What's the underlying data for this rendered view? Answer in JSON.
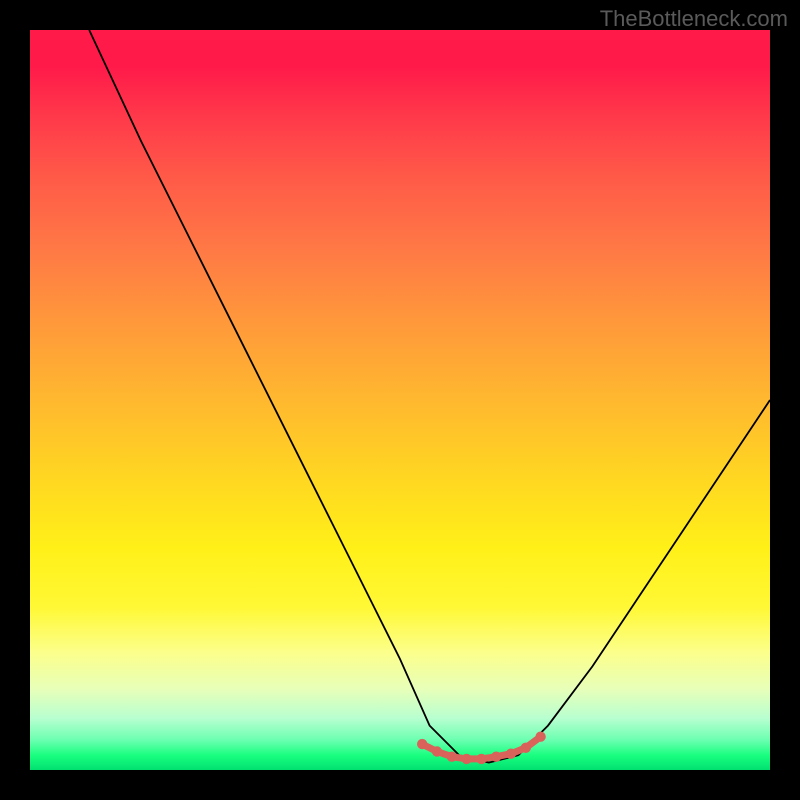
{
  "watermark": "TheBottleneck.com",
  "chart_data": {
    "type": "line",
    "title": "",
    "xlabel": "",
    "ylabel": "",
    "xlim": [
      0,
      100
    ],
    "ylim": [
      0,
      100
    ],
    "grid": false,
    "annotations": [],
    "series": [
      {
        "name": "curve",
        "color": "#000000",
        "x": [
          8,
          15,
          22,
          29,
          36,
          43,
          50,
          54,
          58,
          62,
          66,
          70,
          76,
          82,
          88,
          94,
          100
        ],
        "y": [
          100,
          85,
          71,
          57,
          43,
          29,
          15,
          6,
          2,
          1,
          2,
          6,
          14,
          23,
          32,
          41,
          50
        ]
      },
      {
        "name": "bottom-marker",
        "color": "#d9635a",
        "x": [
          53,
          55,
          57,
          59,
          61,
          63,
          65,
          67,
          69
        ],
        "y": [
          3.5,
          2.5,
          1.8,
          1.5,
          1.5,
          1.8,
          2.2,
          3.0,
          4.5
        ]
      }
    ],
    "gradient_stops": [
      {
        "pos": 0,
        "color": "#ff1a4a"
      },
      {
        "pos": 50,
        "color": "#ffd522"
      },
      {
        "pos": 85,
        "color": "#fcff8a"
      },
      {
        "pos": 100,
        "color": "#00e070"
      }
    ]
  }
}
